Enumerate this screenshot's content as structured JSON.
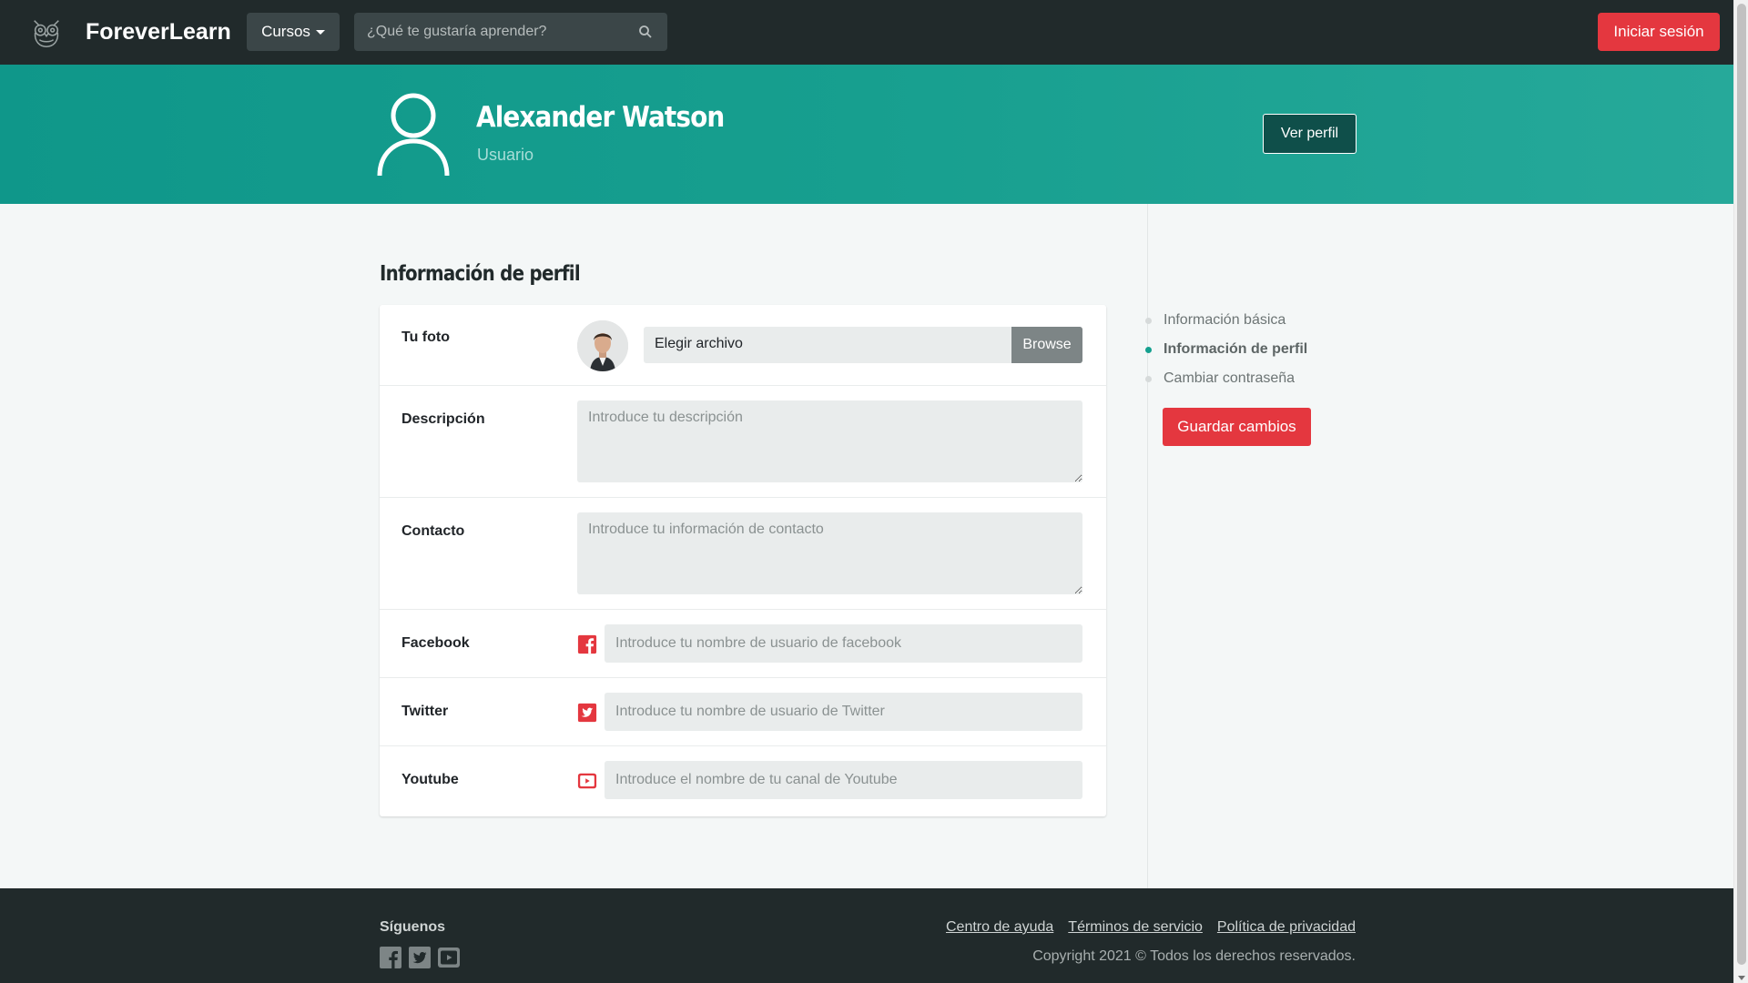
{
  "navbar": {
    "brand": "ForeverLearn",
    "courses_label": "Cursos",
    "search_placeholder": "¿Qué te gustaría aprender?",
    "login_label": "Iniciar sesión"
  },
  "hero": {
    "name": "Alexander Watson",
    "role": "Usuario",
    "view_profile_label": "Ver perfil"
  },
  "main": {
    "section_title": "Información de perfil",
    "photo": {
      "label": "Tu foto",
      "file_label": "Elegir archivo",
      "browse_label": "Browse"
    },
    "description": {
      "label": "Descripción",
      "placeholder": "Introduce tu descripción"
    },
    "contact": {
      "label": "Contacto",
      "placeholder": "Introduce tu información de contacto"
    },
    "facebook": {
      "label": "Facebook",
      "placeholder": "Introduce tu nombre de usuario de facebook",
      "icon": "facebook-icon"
    },
    "twitter": {
      "label": "Twitter",
      "placeholder": "Introduce tu nombre de usuario de Twitter",
      "icon": "twitter-icon"
    },
    "youtube": {
      "label": "Youtube",
      "placeholder": "Introduce el nombre de tu canal de Youtube",
      "icon": "youtube-icon"
    }
  },
  "sidebar": {
    "items": [
      {
        "label": "Información básica",
        "active": false
      },
      {
        "label": "Información de perfil",
        "active": true
      },
      {
        "label": "Cambiar contraseña",
        "active": false
      }
    ],
    "save_label": "Guardar cambios"
  },
  "footer": {
    "follow_title": "Síguenos",
    "links": [
      "Centro de ayuda",
      "Términos de servicio",
      "Política de privacidad"
    ],
    "copyright": "Copyright 2021 © Todos los derechos reservados."
  },
  "colors": {
    "navbar_bg": "#212a2b",
    "accent_teal": "#14a08f",
    "accent_red": "#e4373f"
  }
}
